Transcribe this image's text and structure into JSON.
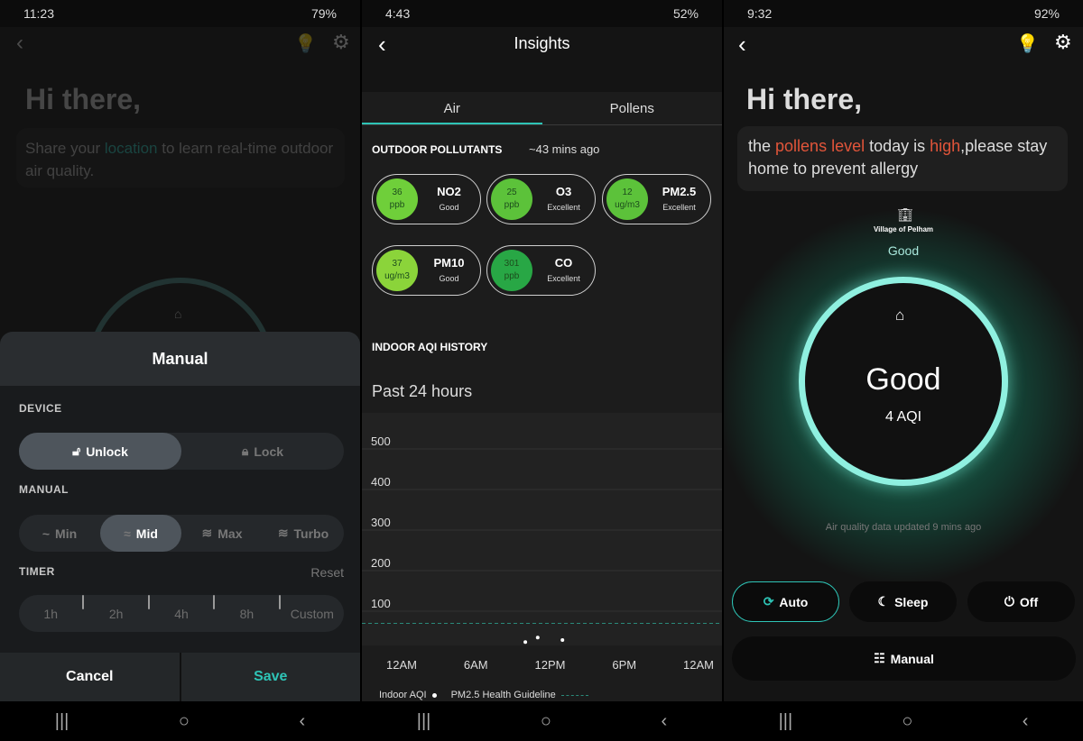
{
  "panel1": {
    "status": {
      "time": "11:23",
      "battery": "79%"
    },
    "greeting": "Hi there,",
    "location_msg": {
      "pre": "Share your ",
      "link": "location",
      "post": " to learn real-time outdoor air quality."
    },
    "sheet": {
      "title": "Manual",
      "device_label": "DEVICE",
      "device_options": [
        "Unlock",
        "Lock"
      ],
      "device_selected": "Unlock",
      "manual_label": "MANUAL",
      "manual_options": [
        "Min",
        "Mid",
        "Max",
        "Turbo"
      ],
      "manual_selected": "Mid",
      "timer_label": "TIMER",
      "reset": "Reset",
      "timer_options": [
        "1h",
        "2h",
        "4h",
        "8h",
        "Custom"
      ],
      "cancel": "Cancel",
      "save": "Save"
    }
  },
  "panel2": {
    "status": {
      "time": "4:43",
      "battery": "52%"
    },
    "title": "Insights",
    "tabs": [
      "Air",
      "Pollens"
    ],
    "active_tab": "Air",
    "outdoor_label": "OUTDOOR POLLUTANTS",
    "outdoor_updated": "~43 mins ago",
    "pollutants": [
      {
        "value": "36",
        "unit": "ppb",
        "name": "NO2",
        "rating": "Good",
        "color": "#6fcf3a"
      },
      {
        "value": "25",
        "unit": "ppb",
        "name": "O3",
        "rating": "Excellent",
        "color": "#5cc23a"
      },
      {
        "value": "12",
        "unit": "ug/m3",
        "name": "PM2.5",
        "rating": "Excellent",
        "color": "#5cc23a"
      },
      {
        "value": "37",
        "unit": "ug/m3",
        "name": "PM10",
        "rating": "Good",
        "color": "#8bd43a"
      },
      {
        "value": "301",
        "unit": "ppb",
        "name": "CO",
        "rating": "Excellent",
        "color": "#28a745"
      }
    ],
    "history_label": "INDOOR AQI HISTORY",
    "range": "Past 24 hours",
    "legend": {
      "indoor": "Indoor AQI",
      "guideline": "PM2.5 Health Guideline"
    }
  },
  "chart_data": {
    "type": "scatter",
    "x_ticks": [
      "12AM",
      "6AM",
      "12PM",
      "6PM",
      "12AM"
    ],
    "y_ticks": [
      100,
      200,
      300,
      400,
      500
    ],
    "ylim": [
      0,
      500
    ],
    "xlim_hours": [
      0,
      24
    ],
    "series": [
      {
        "name": "Indoor AQI",
        "x_hours": [
          10,
          11,
          13
        ],
        "values": [
          4,
          15,
          9
        ],
        "color": "#ffffff"
      }
    ],
    "guideline": {
      "name": "PM2.5 Health Guideline",
      "value": 50,
      "color": "#2a8a7a",
      "style": "dashed"
    },
    "grid": true
  },
  "panel3": {
    "status": {
      "time": "9:32",
      "battery": "92%"
    },
    "greeting": "Hi there,",
    "pollen_msg": {
      "a": "the ",
      "b": "pollens level",
      "c": " today is ",
      "d": "high",
      "e": ",please stay home to prevent allergy"
    },
    "accent_red": "#e2553a",
    "location": "Village of Pelham",
    "outdoor_status": "Good",
    "indoor_status": "Good",
    "aqi": "4 AQI",
    "updated": "Air quality data updated 9 mins ago",
    "modes": [
      "Auto",
      "Sleep",
      "Off"
    ],
    "active_mode": "Auto",
    "manual": "Manual",
    "accent": "#7fe8d8"
  }
}
